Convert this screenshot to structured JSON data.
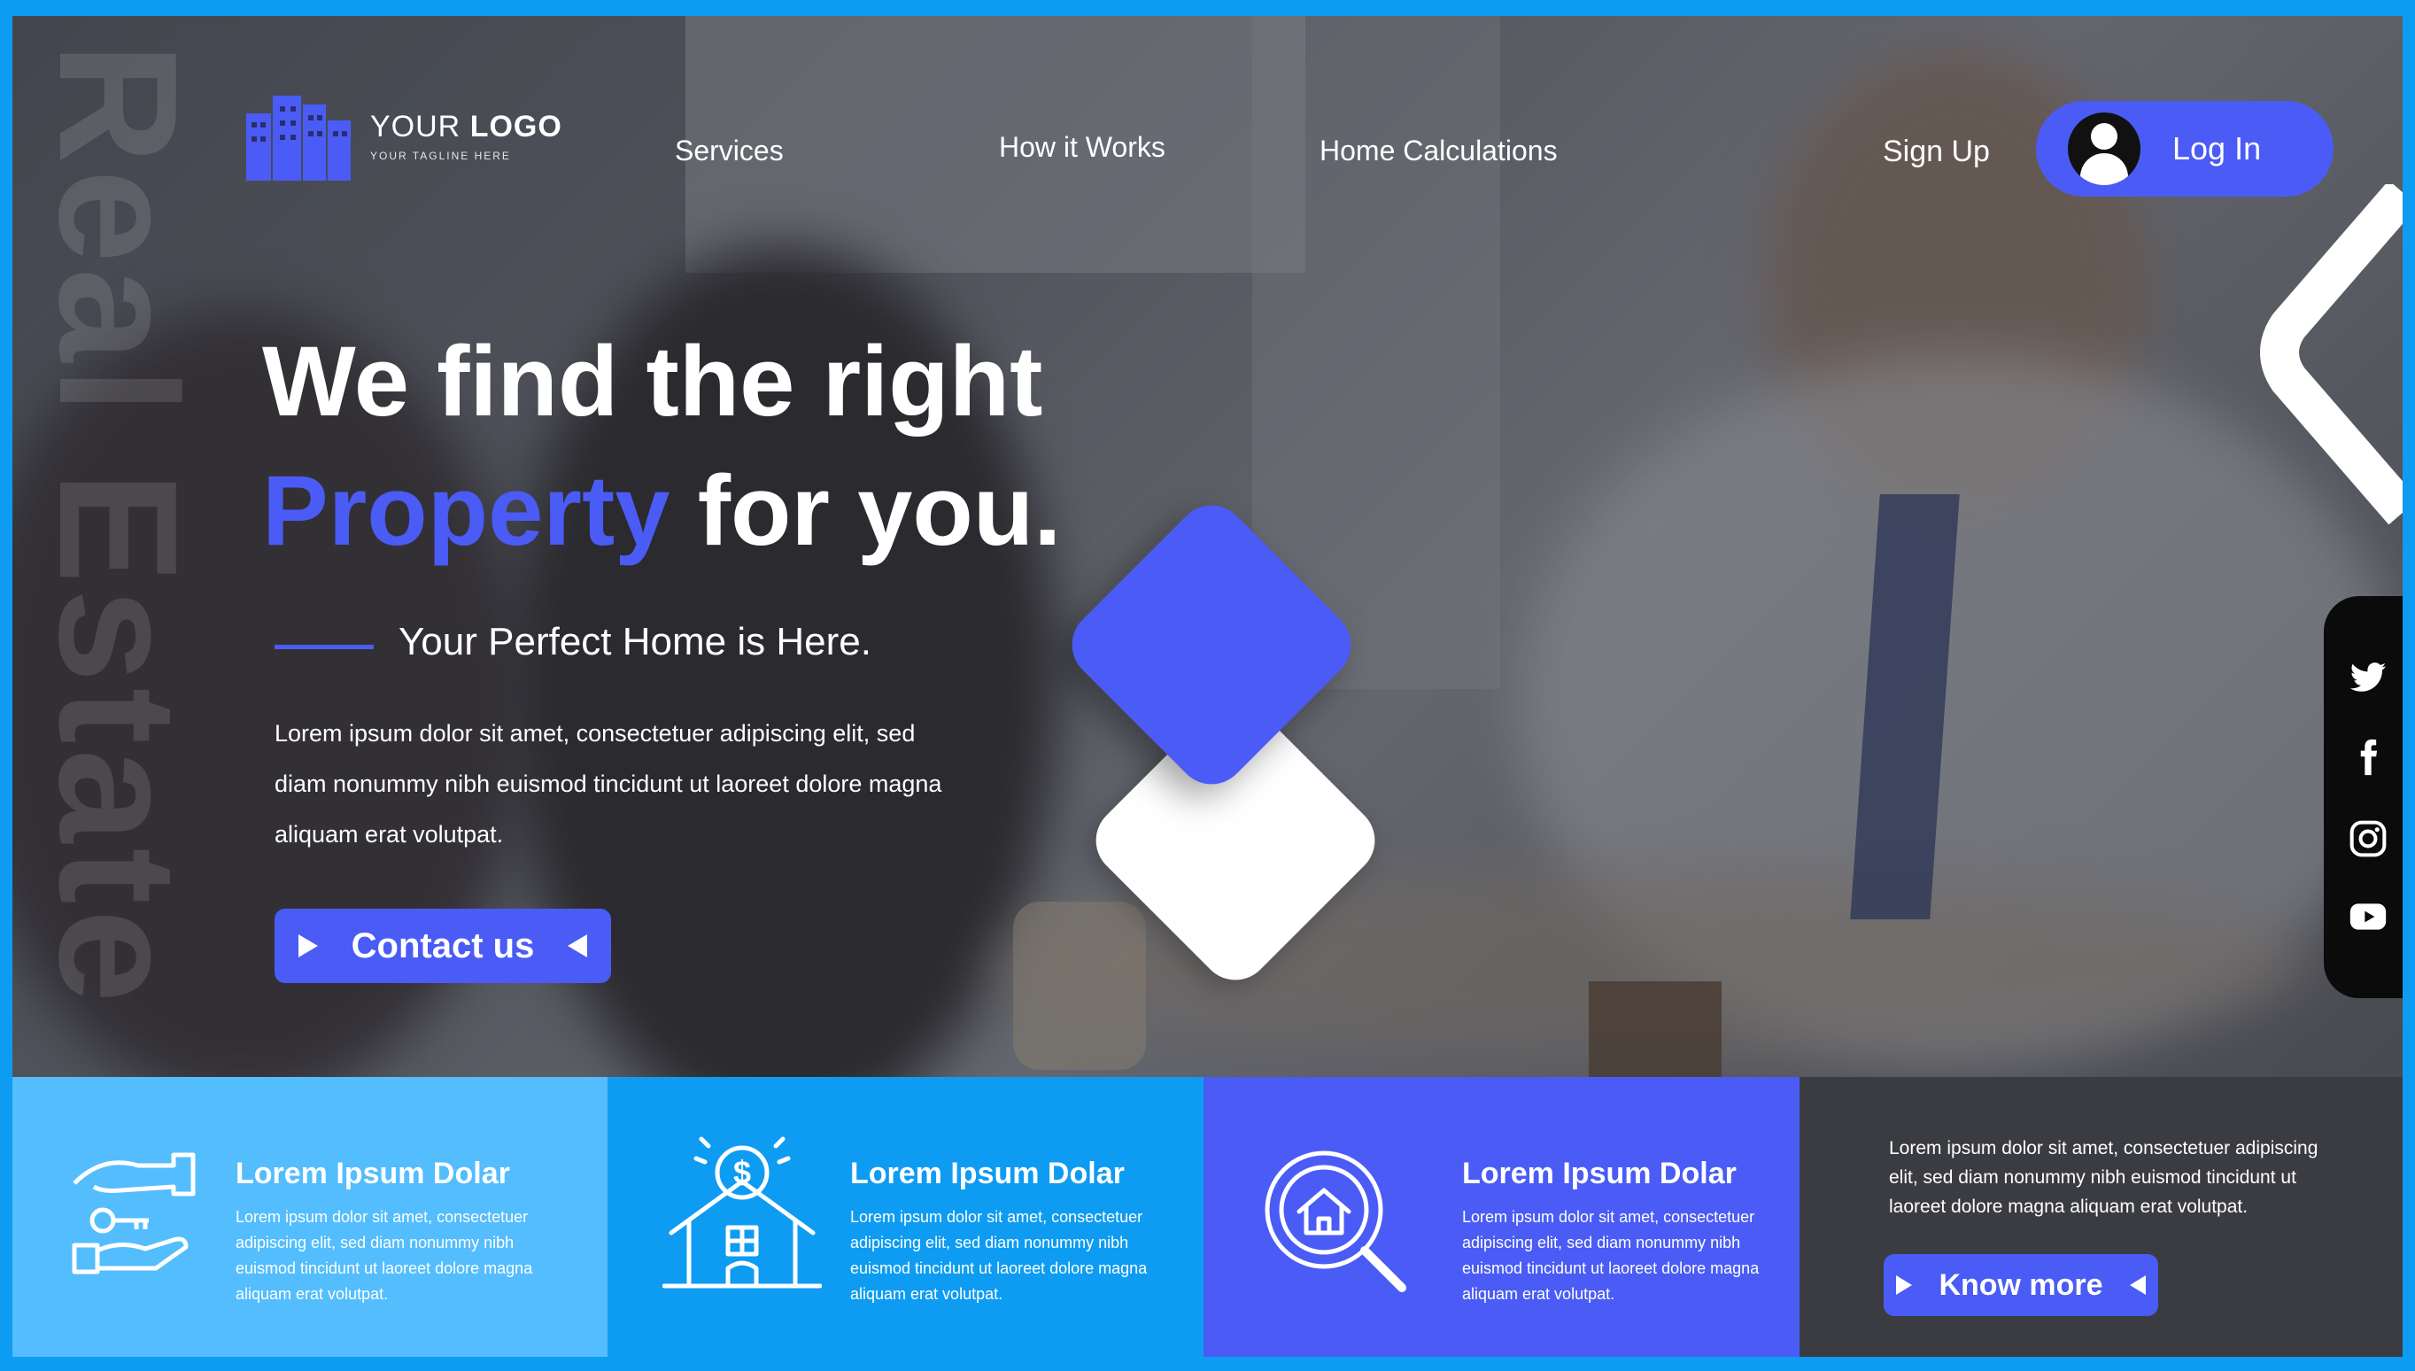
{
  "logo": {
    "main": "YOUR",
    "bold": "LOGO",
    "tagline": "YOUR TAGLINE HERE"
  },
  "watermark": "Real Estate",
  "nav": {
    "items": [
      "Services",
      "How it Works",
      "Home Calculations"
    ],
    "signup": "Sign Up",
    "login": "Log In"
  },
  "hero": {
    "line1": "We find the right",
    "line2_accent": "Property",
    "line2_rest": " for you.",
    "subtitle": "Your Perfect Home is Here.",
    "paragraph": "Lorem ipsum dolor sit amet, consectetuer adipiscing elit, sed diam nonummy nibh euismod tincidunt ut laoreet dolore magna aliquam erat volutpat.",
    "cta": "Contact us"
  },
  "social": [
    "twitter-icon",
    "facebook-icon",
    "instagram-icon",
    "youtube-icon"
  ],
  "features": [
    {
      "icon": "hand-key-icon",
      "title": "Lorem Ipsum Dolar",
      "text": "Lorem ipsum dolor sit amet, consectetuer adipiscing elit, sed diam nonummy nibh euismod tincidunt ut laoreet dolore magna aliquam erat volutpat."
    },
    {
      "icon": "house-dollar-icon",
      "title": "Lorem Ipsum Dolar",
      "text": "Lorem ipsum dolor sit amet, consectetuer adipiscing elit, sed diam nonummy nibh euismod tincidunt ut laoreet dolore magna aliquam erat volutpat."
    },
    {
      "icon": "search-house-icon",
      "title": "Lorem Ipsum Dolar",
      "text": "Lorem ipsum dolor sit amet, consectetuer adipiscing elit, sed diam nonummy nibh euismod tincidunt ut laoreet dolore magna aliquam erat volutpat."
    }
  ],
  "promo": {
    "text": "Lorem ipsum dolor sit amet, consectetuer adipiscing elit, sed diam nonummy nibh euismod tincidunt ut laoreet dolore magna aliquam erat volutpat.",
    "button": "Know more"
  },
  "colors": {
    "accent": "#4a5cf5",
    "light_blue": "#54bdfd",
    "mid_blue": "#0e9cf2",
    "dark": "#3b3c41",
    "frame": "#0e9cf2"
  }
}
